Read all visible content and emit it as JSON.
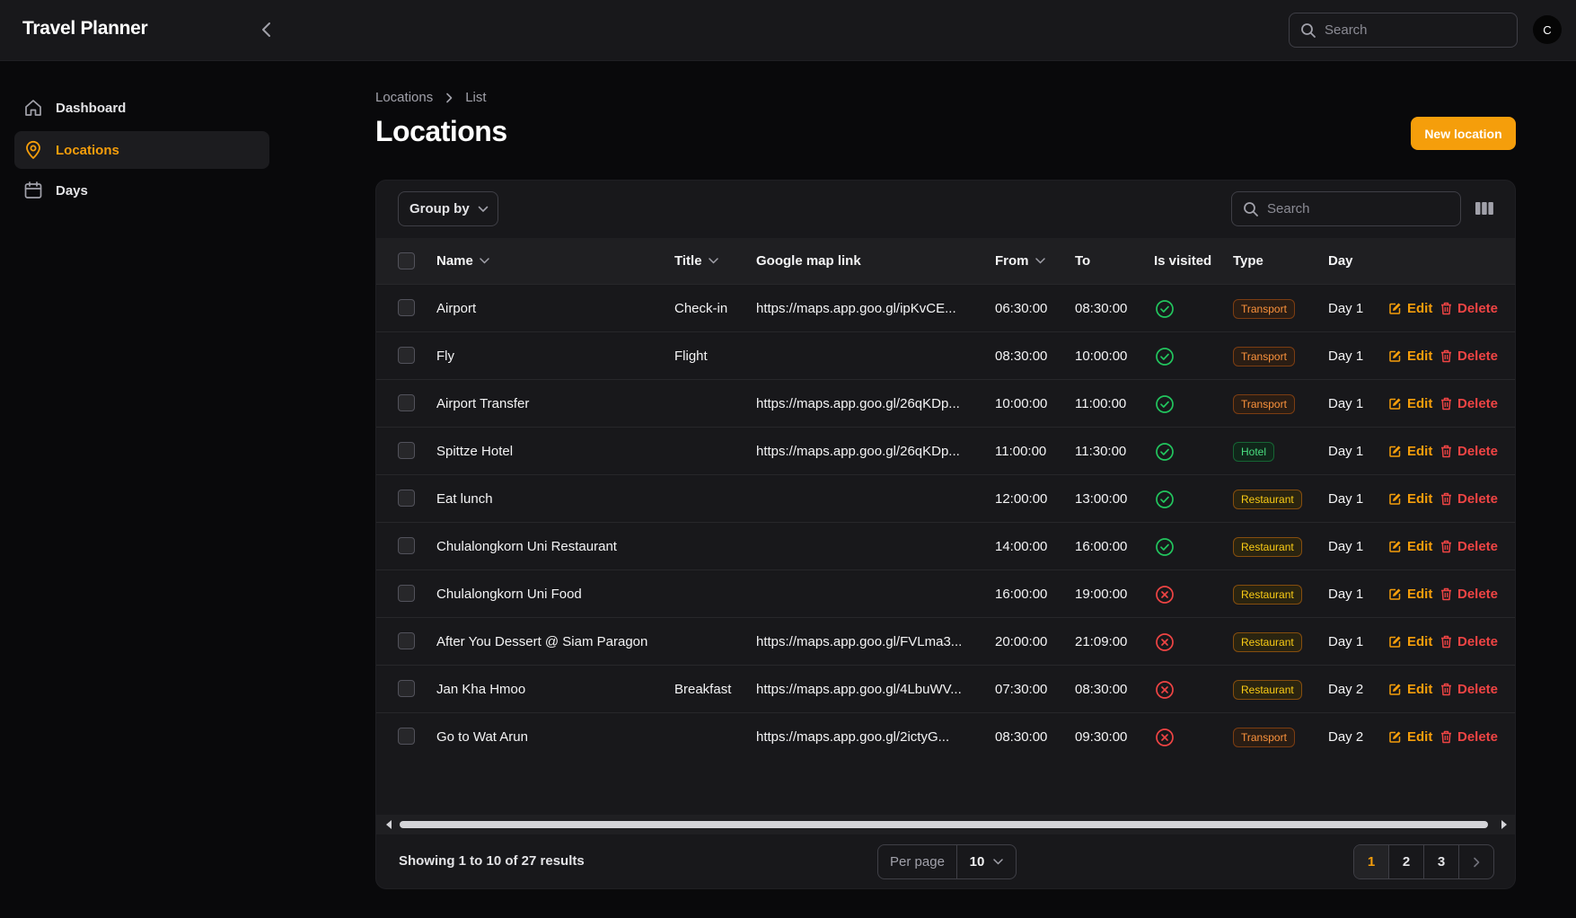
{
  "app": {
    "title": "Travel Planner"
  },
  "topbar": {
    "search_placeholder": "Search",
    "avatar_initial": "C"
  },
  "sidebar": {
    "items": [
      {
        "label": "Dashboard",
        "icon": "home-icon"
      },
      {
        "label": "Locations",
        "icon": "map-pin-icon",
        "active": true
      },
      {
        "label": "Days",
        "icon": "calendar-icon"
      }
    ]
  },
  "breadcrumb": {
    "parent": "Locations",
    "current": "List"
  },
  "page": {
    "title": "Locations",
    "new_button": "New location"
  },
  "toolbar": {
    "group_by": "Group by",
    "search_placeholder": "Search"
  },
  "columns": [
    "Name",
    "Title",
    "Google map link",
    "From",
    "To",
    "Is visited",
    "Type",
    "Day"
  ],
  "actions": {
    "edit": "Edit",
    "delete": "Delete"
  },
  "rows": [
    {
      "name": "Airport",
      "title": "Check-in",
      "link": "https://maps.app.goo.gl/ipKvCE...",
      "from": "06:30:00",
      "to": "08:30:00",
      "visited": true,
      "type": "Transport",
      "day": "Day 1"
    },
    {
      "name": "Fly",
      "title": "Flight",
      "link": "",
      "from": "08:30:00",
      "to": "10:00:00",
      "visited": true,
      "type": "Transport",
      "day": "Day 1"
    },
    {
      "name": "Airport Transfer",
      "title": "",
      "link": "https://maps.app.goo.gl/26qKDp...",
      "from": "10:00:00",
      "to": "11:00:00",
      "visited": true,
      "type": "Transport",
      "day": "Day 1"
    },
    {
      "name": "Spittze Hotel",
      "title": "",
      "link": "https://maps.app.goo.gl/26qKDp...",
      "from": "11:00:00",
      "to": "11:30:00",
      "visited": true,
      "type": "Hotel",
      "day": "Day 1"
    },
    {
      "name": "Eat lunch",
      "title": "",
      "link": "",
      "from": "12:00:00",
      "to": "13:00:00",
      "visited": true,
      "type": "Restaurant",
      "day": "Day 1"
    },
    {
      "name": "Chulalongkorn Uni Restaurant",
      "title": "",
      "link": "",
      "from": "14:00:00",
      "to": "16:00:00",
      "visited": true,
      "type": "Restaurant",
      "day": "Day 1"
    },
    {
      "name": "Chulalongkorn Uni Food",
      "title": "",
      "link": "",
      "from": "16:00:00",
      "to": "19:00:00",
      "visited": false,
      "type": "Restaurant",
      "day": "Day 1"
    },
    {
      "name": "After You Dessert @ Siam Paragon",
      "title": "",
      "link": "https://maps.app.goo.gl/FVLma3...",
      "from": "20:00:00",
      "to": "21:09:00",
      "visited": false,
      "type": "Restaurant",
      "day": "Day 1"
    },
    {
      "name": "Jan Kha Hmoo",
      "title": "Breakfast",
      "link": "https://maps.app.goo.gl/4LbuWV...",
      "from": "07:30:00",
      "to": "08:30:00",
      "visited": false,
      "type": "Restaurant",
      "day": "Day 2"
    },
    {
      "name": "Go to Wat Arun",
      "title": "",
      "link": "https://maps.app.goo.gl/2ictyG...",
      "from": "08:30:00",
      "to": "09:30:00",
      "visited": false,
      "type": "Transport",
      "day": "Day 2"
    }
  ],
  "footer": {
    "summary": "Showing 1 to 10 of 27 results",
    "per_page_label": "Per page",
    "per_page_value": "10",
    "pages": [
      "1",
      "2",
      "3"
    ],
    "current_page": "1"
  },
  "colors": {
    "accent": "#f59e0b",
    "danger": "#ef4444",
    "success": "#22c55e"
  }
}
